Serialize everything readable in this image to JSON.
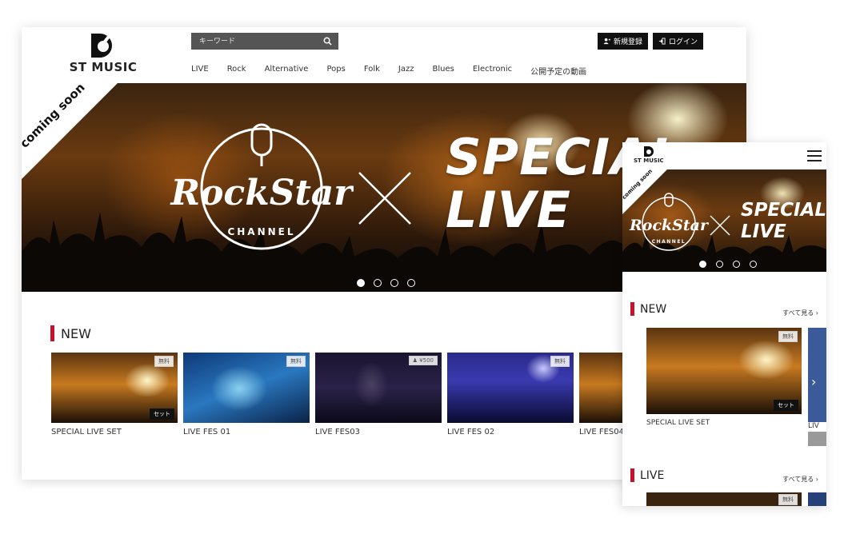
{
  "desktop": {
    "logo": {
      "text": "ST MUSIC"
    },
    "search": {
      "placeholder": "キーワード"
    },
    "auth": {
      "register": "新規登録",
      "login": "ログイン"
    },
    "nav": [
      "LIVE",
      "Rock",
      "Alternative",
      "Pops",
      "Folk",
      "Jazz",
      "Blues",
      "Electronic",
      "公開予定の動画"
    ],
    "hero": {
      "corner_badge": "coming soon",
      "brand_main": "RockStar",
      "brand_sub": "CHANNEL",
      "headline_1": "SPECIAL",
      "headline_2": "LIVE",
      "slide_count": 4,
      "active_slide": 1
    },
    "section_new": {
      "title": "NEW",
      "items": [
        {
          "caption": "SPECIAL LIVE SET",
          "tag": "無料",
          "badge": "セット"
        },
        {
          "caption": "LIVE FES 01",
          "tag": "無料"
        },
        {
          "caption": "LIVE FES03",
          "tag": "¥500"
        },
        {
          "caption": "LIVE FES 02",
          "tag": "無料"
        },
        {
          "caption": "LIVE FES04",
          "tag": ""
        }
      ]
    }
  },
  "mobile": {
    "logo": {
      "text": "ST MUSIC"
    },
    "hero": {
      "corner_badge": "coming soon",
      "brand_main": "RockStar",
      "brand_sub": "CHANNEL",
      "headline_1": "SPECIAL",
      "headline_2": "LIVE"
    },
    "section_new": {
      "title": "NEW",
      "see_all": "すべて見る ›",
      "item": {
        "caption": "SPECIAL LIVE SET",
        "tag": "無料",
        "badge": "セット"
      },
      "next_caption_partial": "LIV"
    },
    "section_live": {
      "title": "LIVE",
      "see_all": "すべて見る ›",
      "tag": "無料"
    }
  },
  "colors": {
    "accent": "#c4122f",
    "button_dark": "#111111",
    "search_bg": "#555555"
  }
}
